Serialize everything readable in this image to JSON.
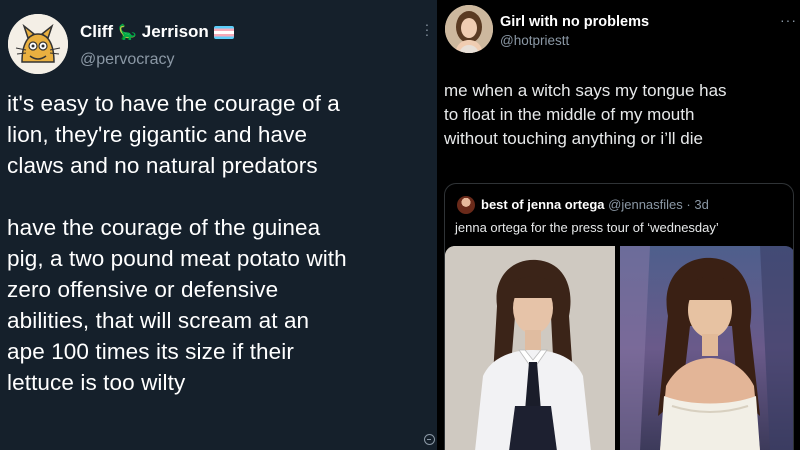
{
  "left_tweet": {
    "display_name": "Cliff",
    "display_name_last": "Jerrison",
    "name_emoji": "🦕",
    "flag_name": "transgender-flag",
    "handle": "@pervocracy",
    "paragraph1": [
      "it's easy to have the courage of a",
      "lion, they're gigantic and have",
      "claws and no natural predators"
    ],
    "paragraph2": [
      "have the courage of the guinea",
      "pig, a two pound meat potato with",
      "zero offensive or defensive",
      "abilities, that will scream at an",
      "ape 100 times its size if their",
      "lettuce is too wilty"
    ],
    "background_color": "#15202b"
  },
  "right_tweet": {
    "display_name": "Girl with no problems",
    "handle": "@hotpriestt",
    "more_icon": "···",
    "body_lines": [
      "me when a witch says my tongue has",
      "to float in the middle of my mouth",
      "without touching anything or i’ll die"
    ],
    "quote": {
      "name": "best of jenna ortega",
      "handle": "@jennasfiles",
      "time": "· 3d",
      "text": "jenna ortega for the press tour of ‘wednesday’"
    }
  }
}
